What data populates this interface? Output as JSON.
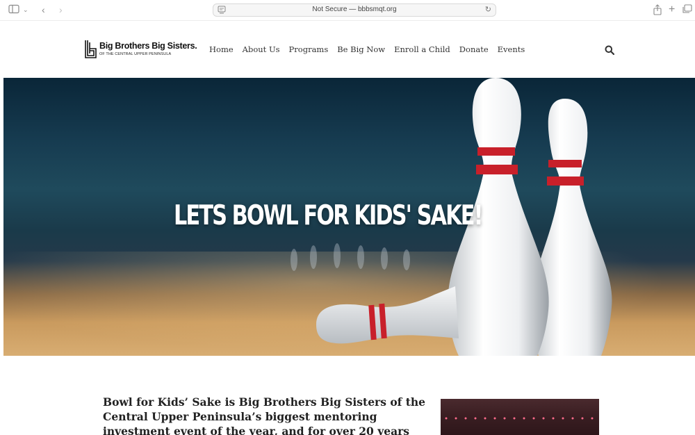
{
  "browser": {
    "address_text": "Not Secure — bbbsmqt.org"
  },
  "site": {
    "logo": {
      "title": "Big Brothers Big Sisters.",
      "subtitle": "OF THE CENTRAL UPPER PENINSULA"
    },
    "nav": [
      "Home",
      "About Us",
      "Programs",
      "Be Big Now",
      "Enroll a Child",
      "Donate",
      "Events"
    ]
  },
  "hero": {
    "title": "LETS BOWL FOR KIDS' SAKE!"
  },
  "content": {
    "intro": "Bowl for Kids’ Sake is Big Brothers Big Sisters of the Central Upper Peninsula’s biggest mentoring investment event of the year, and for over 20 years"
  },
  "colors": {
    "pin_stripe": "#c8202a",
    "hero_bg": "#163b50"
  }
}
